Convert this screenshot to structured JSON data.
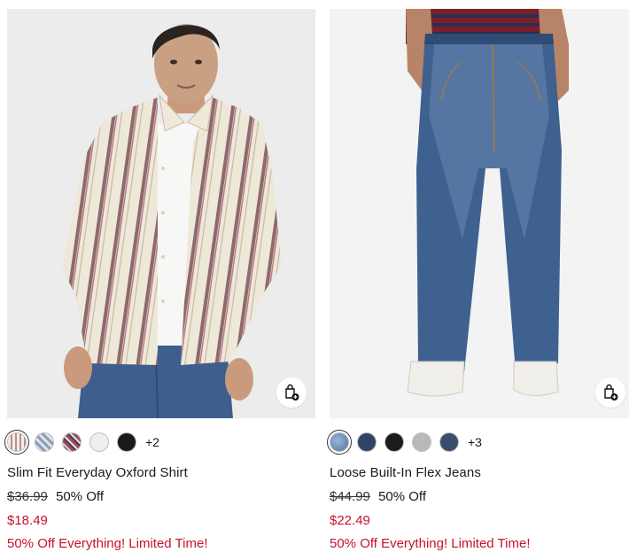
{
  "colors": {
    "sale_red": "#c8102e",
    "text": "#1a1a1a"
  },
  "products": [
    {
      "name": "Slim Fit Everyday Oxford Shirt",
      "original_price": "$36.99",
      "discount": "50% Off",
      "sale_price": "$18.49",
      "promo": "50% Off Everything! Limited Time!",
      "more_colors": "+2",
      "swatch_colors": [
        "#efe6df",
        "#8aa0b8",
        "#a34a55",
        "#eeeeee",
        "#1a1a1a"
      ],
      "image_alt": "Man wearing striped oxford shirt",
      "bag_icon": "add-to-bag-icon"
    },
    {
      "name": "Loose Built-In Flex Jeans",
      "original_price": "$44.99",
      "discount": "50% Off",
      "sale_price": "$22.49",
      "promo": "50% Off Everything! Limited Time!",
      "more_colors": "+3",
      "swatch_colors": [
        "#6f93bb",
        "#2d4566",
        "#1c1c1c",
        "#b9b9b9",
        "#3a4d6e"
      ],
      "image_alt": "Man wearing loose blue jeans",
      "bag_icon": "add-to-bag-icon"
    }
  ]
}
